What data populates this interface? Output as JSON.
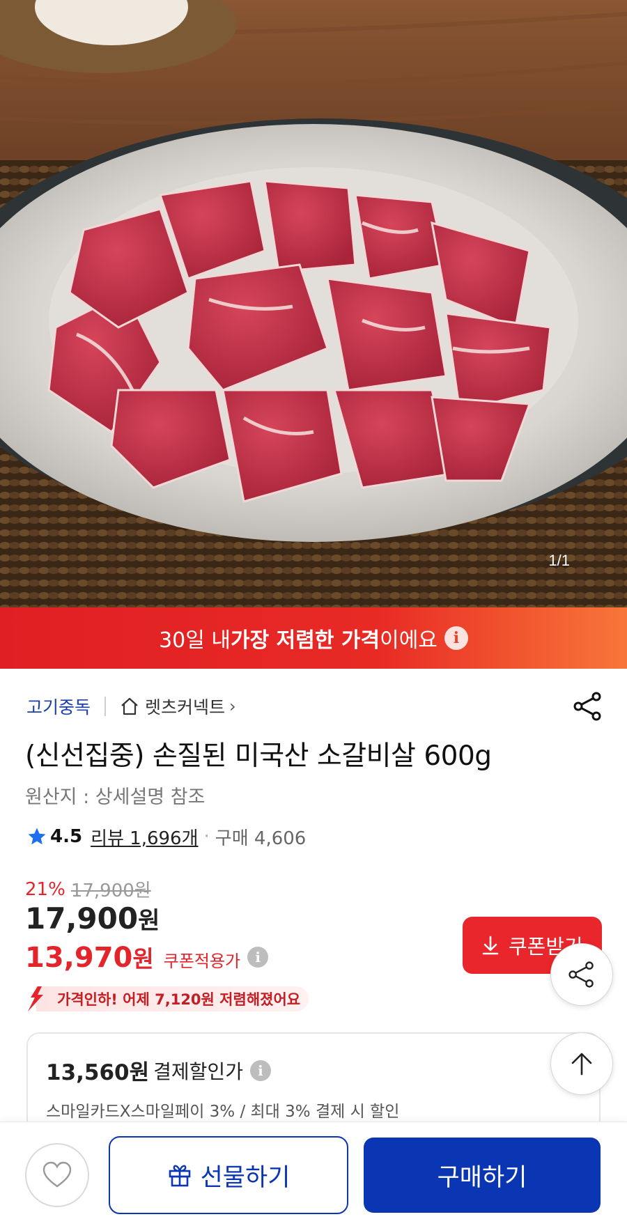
{
  "hero": {
    "image_alt": "raw marinated beef short rib chunks on a white plate",
    "counter": "1/1"
  },
  "banner": {
    "pre": "30일 내 ",
    "bold": "가장 저렴한 가격",
    "post": "이에요",
    "info": "i"
  },
  "product": {
    "brand": "고기중독",
    "store": "렛츠커넥트",
    "title": "(신선집중) 손질된 미국산 소갈비살 600g",
    "origin": "원산지 : 상세설명 참조",
    "rating": "4.5",
    "reviews": "리뷰 1,696개",
    "dot": "·",
    "purchases": "구매 4,606"
  },
  "pricing": {
    "discount_pct": "21%",
    "original_price": "17,900원",
    "price_number": "17,900",
    "price_unit": "원",
    "coupon_price_number": "13,970",
    "coupon_price_unit": "원",
    "coupon_label": "쿠폰적용가",
    "info": "i",
    "coupon_button": "쿠폰받기",
    "price_drop": "가격인하! 어제 7,120원 저렴해졌어요"
  },
  "payment": {
    "amount": "13,560원",
    "label": "결제할인가",
    "info": "i",
    "description": "스마일카드X스마일페이 3% / 최대 3% 결제 시 할인"
  },
  "bottom": {
    "gift_label": "선물하기",
    "buy_label": "구매하기"
  },
  "colors": {
    "accent_red": "#e4242b",
    "primary_blue": "#0b36b3",
    "brand_link": "#1b3fa8"
  },
  "icons": [
    "home-icon",
    "share-icon",
    "star-icon",
    "info-icon",
    "download-icon",
    "price-down-arrow-icon",
    "arrow-up-icon",
    "heart-icon",
    "gift-icon"
  ]
}
